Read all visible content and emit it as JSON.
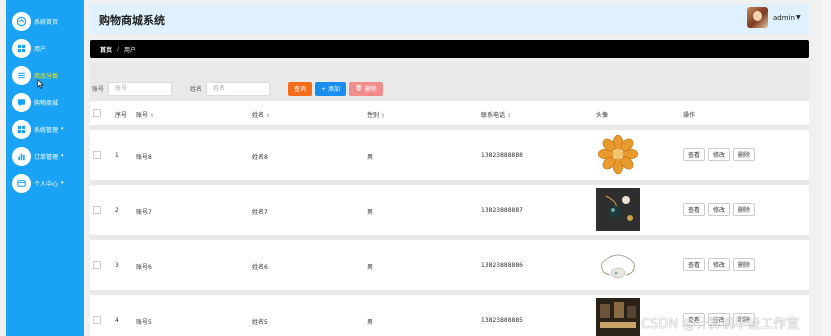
{
  "app": {
    "title": "购物商城系统"
  },
  "header": {
    "username": "admin"
  },
  "sidebar": {
    "items": [
      {
        "label": "系统首页",
        "icon": "home-icon"
      },
      {
        "label": "用户",
        "icon": "grid-icon"
      },
      {
        "label": "商品分类",
        "icon": "list-icon"
      },
      {
        "label": "购物商城",
        "icon": "chat-icon"
      },
      {
        "label": "系统管理",
        "icon": "grid-icon"
      },
      {
        "label": "订单管理",
        "icon": "chart-icon"
      },
      {
        "label": "个人中心",
        "icon": "card-icon"
      }
    ]
  },
  "breadcrumb": {
    "home": "首页",
    "separator": "/",
    "current": "用户"
  },
  "search": {
    "account_label": "账号",
    "account_placeholder": "账号",
    "name_label": "姓名",
    "name_placeholder": "姓名",
    "query_label": "查询",
    "add_label": "+ 添加",
    "delete_label": "删除"
  },
  "table": {
    "headers": {
      "index": "序号",
      "account": "账号",
      "name": "姓名",
      "gender": "性别",
      "phone": "联系电话",
      "avatar": "头像",
      "actions": "操作"
    },
    "action_labels": {
      "view": "查看",
      "edit": "修改",
      "delete": "删除"
    },
    "rows": [
      {
        "index": "1",
        "account": "账号8",
        "name": "姓名8",
        "gender": "男",
        "phone": "13823888888"
      },
      {
        "index": "2",
        "account": "账号7",
        "name": "姓名7",
        "gender": "男",
        "phone": "13823888887"
      },
      {
        "index": "3",
        "account": "账号6",
        "name": "姓名6",
        "gender": "男",
        "phone": "13823888886"
      },
      {
        "index": "4",
        "account": "账号5",
        "name": "姓名5",
        "gender": "男",
        "phone": "13823888885"
      }
    ]
  },
  "watermark": "CSDN @计算机毕设工作室",
  "colors": {
    "sidebar": "#1aa3f5",
    "header": "#dff1fd",
    "query": "#f56c1b",
    "add": "#1a8ef0",
    "delete": "#f08c8c",
    "active_menu": "#ffe600"
  }
}
